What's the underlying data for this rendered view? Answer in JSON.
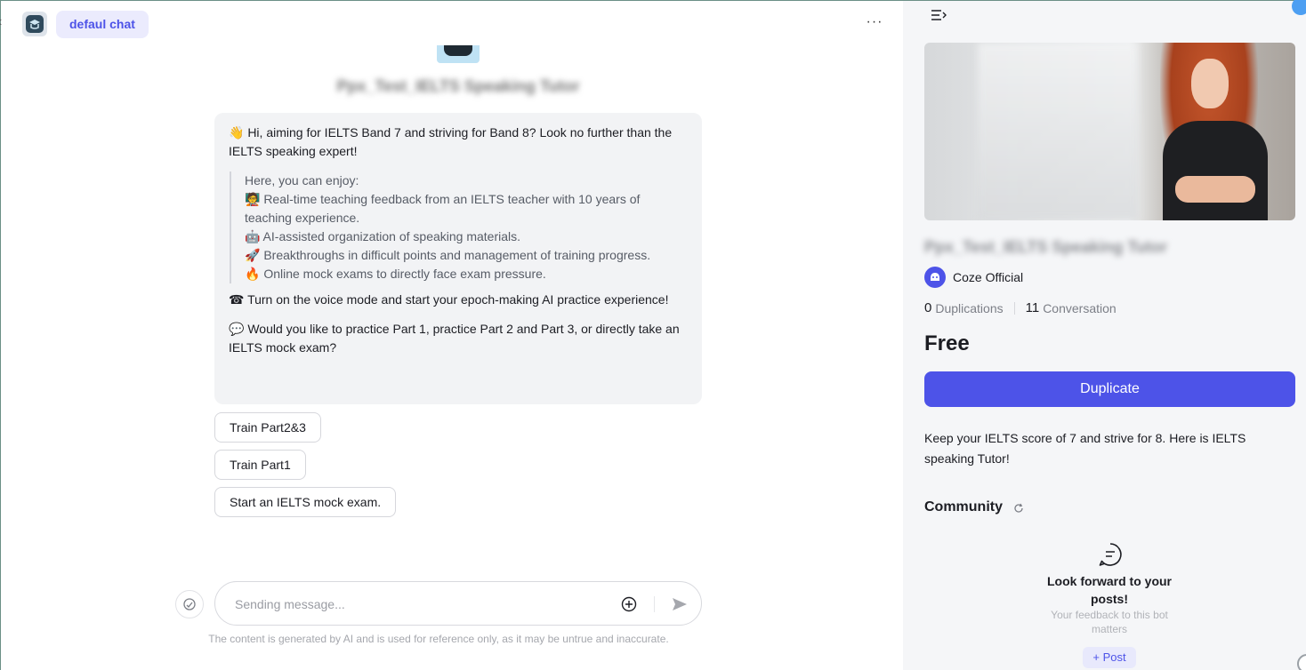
{
  "header": {
    "tab_label": "defaul chat",
    "more_label": "···"
  },
  "bot": {
    "name": "Ppx_Test_IELTS Speaking Tutor"
  },
  "message": {
    "lead": "👋 Hi, aiming for IELTS Band 7 and striving for Band 8? Look no further than the IELTS speaking expert!",
    "quote_lines": [
      "Here, you can enjoy:",
      "🧑‍🏫 Real-time teaching feedback from an IELTS teacher with 10 years of teaching experience.",
      "🤖 AI-assisted organization of speaking materials.",
      "🚀 Breakthroughs in difficult points and management of training progress.",
      "🔥 Online mock exams to directly face exam pressure."
    ],
    "voice": "☎ Turn on the voice mode and start your epoch-making AI practice experience!",
    "question": "💬 Would you like to practice Part 1, practice Part 2 and Part 3, or directly take an IELTS mock exam?"
  },
  "suggestions": [
    "Train Part2&3",
    "Train Part1",
    "Start an IELTS mock exam."
  ],
  "input": {
    "placeholder": "Sending message..."
  },
  "disclaimer": "The content is generated by AI and is used for reference only, as it may be untrue and inaccurate.",
  "info": {
    "creator": "Coze Official",
    "duplications_count": "0",
    "duplications_label": "Duplications",
    "conversation_count": "11",
    "conversation_label": "Conversation",
    "price": "Free",
    "duplicate_label": "Duplicate",
    "description": "Keep your IELTS score of 7 and strive for 8. Here is IELTS speaking Tutor!",
    "community_title": "Community",
    "empty_title": "Look forward to your posts!",
    "empty_sub": "Your feedback to this bot matters",
    "post_label": "+ Post"
  },
  "colors": {
    "accent": "#4d53e8",
    "message_bg": "#f2f3f5",
    "side_bg": "#f5f6f8"
  }
}
